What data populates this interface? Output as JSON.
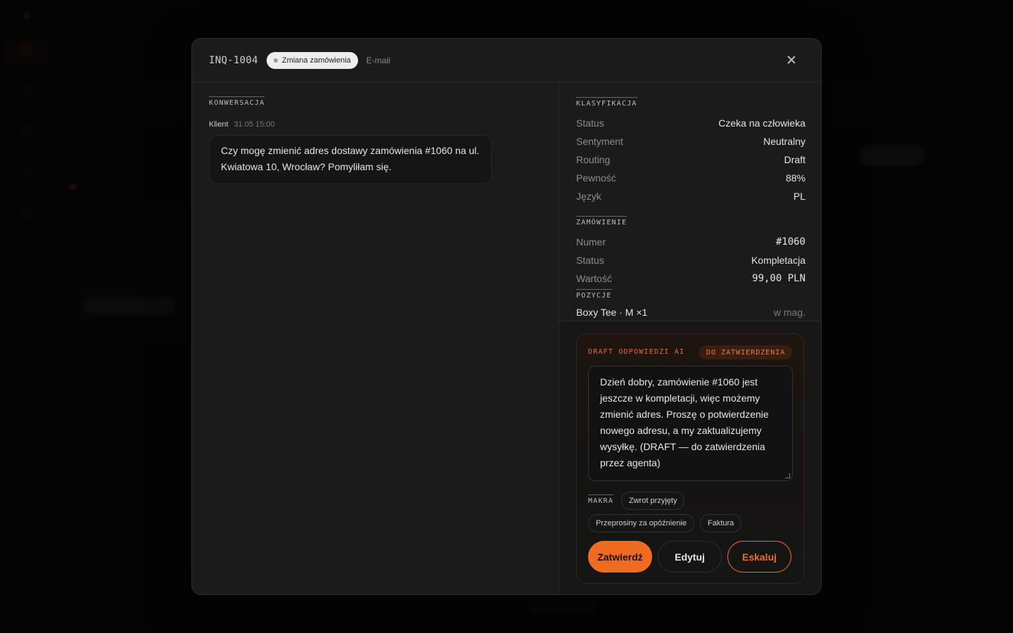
{
  "modal": {
    "inquiry_id": "INQ-1004",
    "type_badge": "Zmiana zamówienia",
    "channel": "E-mail"
  },
  "conversation": {
    "section_label": "KONWERSACJA",
    "messages": [
      {
        "author": "Klient",
        "time": "31.05 15:00",
        "text": "Czy mogę zmienić adres dostawy zamówienia #1060 na ul. Kwiatowa 10, Wrocław? Pomyliłam się."
      }
    ]
  },
  "classification": {
    "section_label": "KLASYFIKACJA",
    "rows": [
      {
        "key": "Status",
        "value": "Czeka na człowieka"
      },
      {
        "key": "Sentyment",
        "value": "Neutralny"
      },
      {
        "key": "Routing",
        "value": "Draft"
      },
      {
        "key": "Pewność",
        "value": "88%"
      },
      {
        "key": "Język",
        "value": "PL"
      }
    ]
  },
  "order": {
    "section_label": "ZAMÓWIENIE",
    "rows": [
      {
        "key": "Numer",
        "value": "#1060"
      },
      {
        "key": "Status",
        "value": "Kompletacja"
      },
      {
        "key": "Wartość",
        "value": "99,00 PLN"
      }
    ],
    "positions_label": "POZYCJE",
    "positions": [
      {
        "name": "Boxy Tee · M ×1",
        "stock": "w mag."
      }
    ]
  },
  "draft": {
    "title": "DRAFT ODPOWIEDZI AI",
    "badge": "DO ZATWIERDZENIA",
    "text": "Dzień dobry, zamówienie #1060 jest jeszcze w kompletacji, więc możemy zmienić adres. Proszę o potwierdzenie nowego adresu, a my zaktualizujemy wysyłkę. (DRAFT — do zatwierdzenia przez agenta)",
    "macros_label": "MAKRA",
    "macros": [
      "Zwrot przyjęty",
      "Przeprosiny za opóźnienie",
      "Faktura"
    ],
    "actions": {
      "approve": "Zatwierdź",
      "edit": "Edytuj",
      "escalate": "Eskaluj"
    }
  },
  "colors": {
    "accent": "#f06b22",
    "modal_bg": "#1b1b1b",
    "page_bg": "#0a0a0a"
  }
}
